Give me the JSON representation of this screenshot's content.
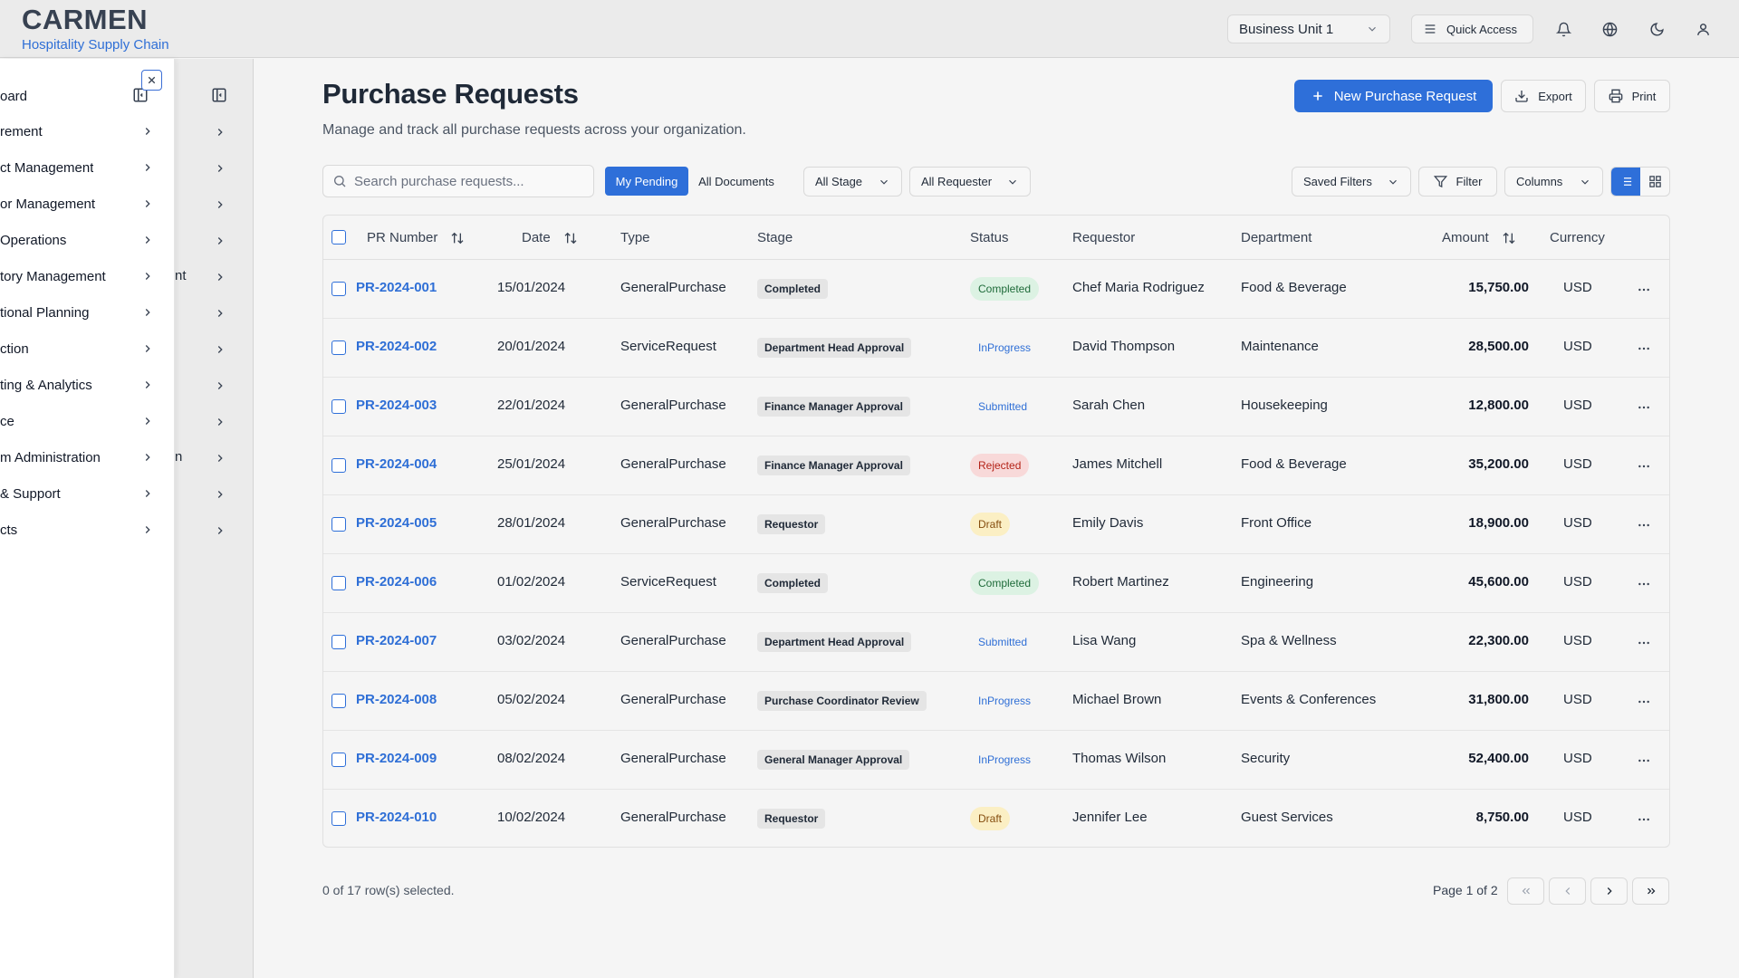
{
  "header": {
    "brand_title": "CARMEN",
    "brand_subtitle": "Hospitality Supply Chain",
    "business_unit": "Business Unit 1",
    "quick_access": "Quick Access",
    "icons": [
      "bell-icon",
      "globe-icon",
      "moon-icon",
      "user-icon"
    ]
  },
  "sidebar_back": {
    "fragments": [
      "nt",
      "n"
    ]
  },
  "sidebar_front": {
    "items": [
      {
        "label": "oard"
      },
      {
        "label": "rement"
      },
      {
        "label": "ct Management"
      },
      {
        "label": "or Management"
      },
      {
        "label": "Operations"
      },
      {
        "label": "tory Management"
      },
      {
        "label": "tional Planning"
      },
      {
        "label": "ction"
      },
      {
        "label": "ting & Analytics"
      },
      {
        "label": "ce"
      },
      {
        "label": "m Administration"
      },
      {
        "label": "& Support"
      },
      {
        "label": "cts"
      }
    ]
  },
  "page": {
    "title": "Purchase Requests",
    "description": "Manage and track all purchase requests across your organization.",
    "new_button": "New Purchase Request",
    "export_button": "Export",
    "print_button": "Print"
  },
  "toolbar": {
    "search_placeholder": "Search purchase requests...",
    "tab_my_pending": "My Pending",
    "tab_all_documents": "All Documents",
    "stage_filter": "All Stage",
    "requester_filter": "All Requester",
    "saved_filters": "Saved Filters",
    "filter": "Filter",
    "columns": "Columns"
  },
  "table": {
    "headers": {
      "pr_number": "PR Number",
      "date": "Date",
      "type": "Type",
      "stage": "Stage",
      "status": "Status",
      "requestor": "Requestor",
      "department": "Department",
      "amount": "Amount",
      "currency": "Currency"
    },
    "rows": [
      {
        "pr": "PR-2024-001",
        "date": "15/01/2024",
        "type": "GeneralPurchase",
        "stage": "Completed",
        "status": "Completed",
        "requestor": "Chef Maria Rodriguez",
        "department": "Food & Beverage",
        "amount": "15,750.00",
        "currency": "USD"
      },
      {
        "pr": "PR-2024-002",
        "date": "20/01/2024",
        "type": "ServiceRequest",
        "stage": "Department Head Approval",
        "status": "InProgress",
        "requestor": "David Thompson",
        "department": "Maintenance",
        "amount": "28,500.00",
        "currency": "USD"
      },
      {
        "pr": "PR-2024-003",
        "date": "22/01/2024",
        "type": "GeneralPurchase",
        "stage": "Finance Manager Approval",
        "status": "Submitted",
        "requestor": "Sarah Chen",
        "department": "Housekeeping",
        "amount": "12,800.00",
        "currency": "USD"
      },
      {
        "pr": "PR-2024-004",
        "date": "25/01/2024",
        "type": "GeneralPurchase",
        "stage": "Finance Manager Approval",
        "status": "Rejected",
        "requestor": "James Mitchell",
        "department": "Food & Beverage",
        "amount": "35,200.00",
        "currency": "USD"
      },
      {
        "pr": "PR-2024-005",
        "date": "28/01/2024",
        "type": "GeneralPurchase",
        "stage": "Requestor",
        "status": "Draft",
        "requestor": "Emily Davis",
        "department": "Front Office",
        "amount": "18,900.00",
        "currency": "USD"
      },
      {
        "pr": "PR-2024-006",
        "date": "01/02/2024",
        "type": "ServiceRequest",
        "stage": "Completed",
        "status": "Completed",
        "requestor": "Robert Martinez",
        "department": "Engineering",
        "amount": "45,600.00",
        "currency": "USD"
      },
      {
        "pr": "PR-2024-007",
        "date": "03/02/2024",
        "type": "GeneralPurchase",
        "stage": "Department Head Approval",
        "status": "Submitted",
        "requestor": "Lisa Wang",
        "department": "Spa & Wellness",
        "amount": "22,300.00",
        "currency": "USD"
      },
      {
        "pr": "PR-2024-008",
        "date": "05/02/2024",
        "type": "GeneralPurchase",
        "stage": "Purchase Coordinator Review",
        "status": "InProgress",
        "requestor": "Michael Brown",
        "department": "Events & Conferences",
        "amount": "31,800.00",
        "currency": "USD"
      },
      {
        "pr": "PR-2024-009",
        "date": "08/02/2024",
        "type": "GeneralPurchase",
        "stage": "General Manager Approval",
        "status": "InProgress",
        "requestor": "Thomas Wilson",
        "department": "Security",
        "amount": "52,400.00",
        "currency": "USD"
      },
      {
        "pr": "PR-2024-010",
        "date": "10/02/2024",
        "type": "GeneralPurchase",
        "stage": "Requestor",
        "status": "Draft",
        "requestor": "Jennifer Lee",
        "department": "Guest Services",
        "amount": "8,750.00",
        "currency": "USD"
      }
    ]
  },
  "status_colors": {
    "Completed": {
      "bg": "#dcf2e3",
      "fg": "#1f6b3a"
    },
    "InProgress": {
      "bg": "transparent",
      "fg": "#2f6fd6"
    },
    "Submitted": {
      "bg": "transparent",
      "fg": "#2f6fd6"
    },
    "Rejected": {
      "bg": "#f8d9d9",
      "fg": "#b42318"
    },
    "Draft": {
      "bg": "#fbefc4",
      "fg": "#854d0e"
    }
  },
  "footer": {
    "selection": "0 of 17 row(s) selected.",
    "page_label": "Page 1 of 2"
  },
  "colors": {
    "accent": "#2e6fd9",
    "link": "#2f6fd6"
  }
}
